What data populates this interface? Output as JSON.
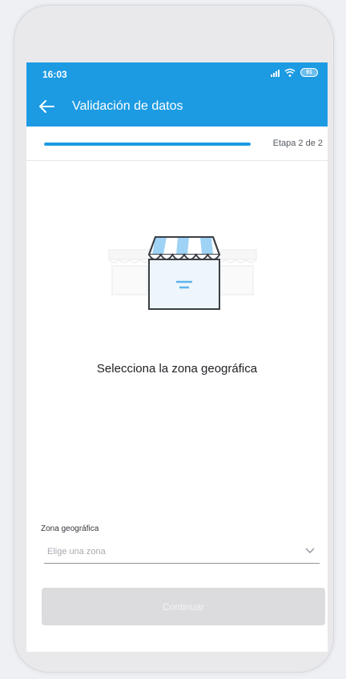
{
  "status_bar": {
    "time": "16:03",
    "battery": "91"
  },
  "app_bar": {
    "title": "Validación de datos",
    "back_icon": "arrow-left-icon"
  },
  "progress": {
    "label": "Etapa 2 de 2",
    "fraction": 1.0
  },
  "illustration": {
    "icon": "storefront-icon"
  },
  "content": {
    "heading": "Selecciona la zona geográfica"
  },
  "form": {
    "zone_label": "Zona geográfica",
    "zone_placeholder": "Elige una zona",
    "zone_icon": "chevron-down-icon",
    "continue_label": "Continuar"
  },
  "colors": {
    "primary": "#1c9be3",
    "disabled_button": "#dcdcde"
  }
}
